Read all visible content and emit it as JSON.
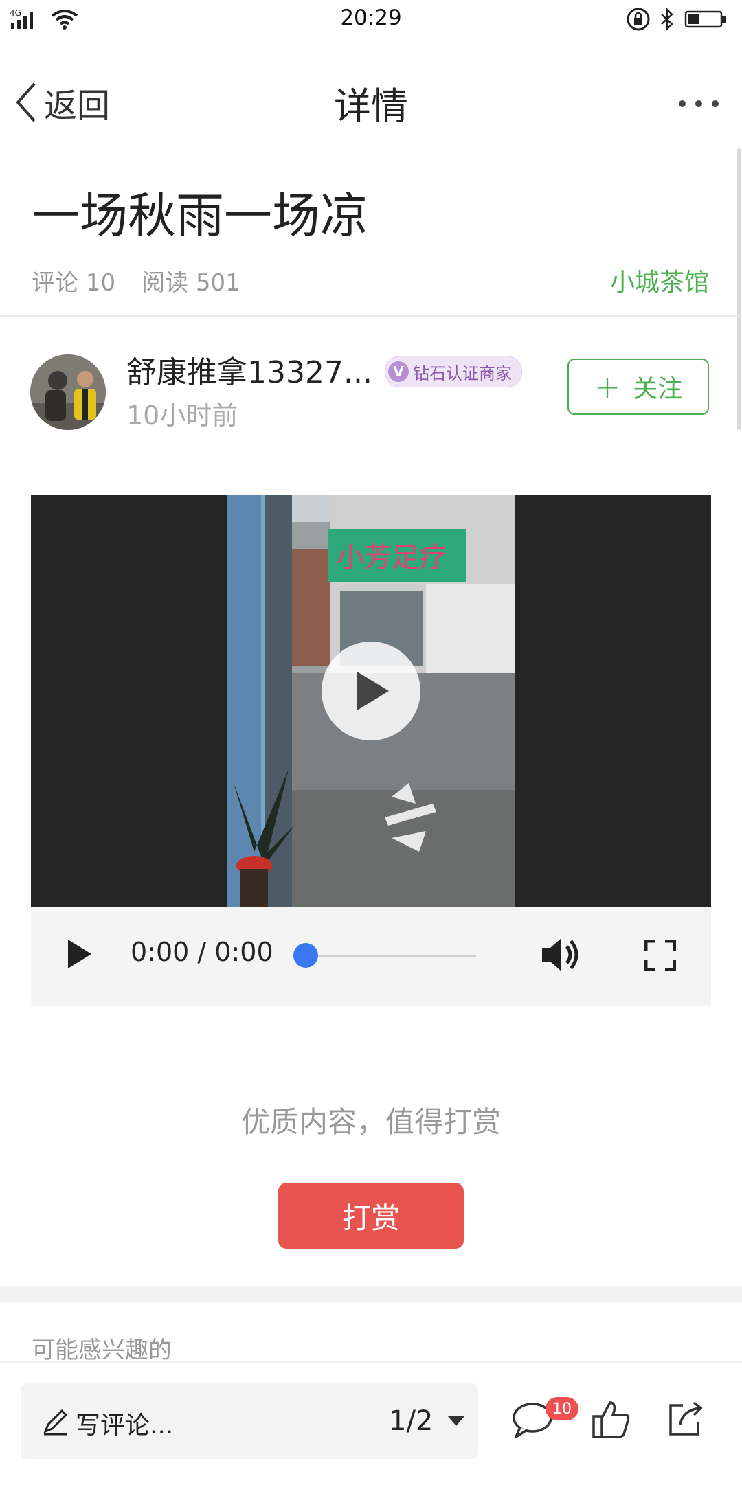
{
  "status_bar": {
    "time": "20:29",
    "network": "4G"
  },
  "nav": {
    "back_label": "返回",
    "title": "详情"
  },
  "article": {
    "title": "一场秋雨一场凉",
    "comments_label": "评论 10",
    "reads_label": "阅读 501",
    "channel": "小城茶馆"
  },
  "author": {
    "name": "舒康推拿13327...",
    "badge": "钻石认证商家",
    "badge_letter": "V",
    "time": "10小时前",
    "follow_label": "关注"
  },
  "video": {
    "shop_sign": "小芳足疗",
    "time_display": "0:00 / 0:00",
    "progress": 0
  },
  "reward": {
    "prompt": "优质内容，值得打赏",
    "button_label": "打赏"
  },
  "related": {
    "label": "可能感兴趣的"
  },
  "bottom_bar": {
    "comment_placeholder": "写评论...",
    "page_indicator": "1/2",
    "comment_count": "10"
  },
  "colors": {
    "accent_green": "#4caf50",
    "reward_red": "#e85550",
    "progress_blue": "#3a78f2",
    "badge_red": "#f05050"
  },
  "icons": [
    "signal-icon",
    "wifi-icon",
    "lock-icon",
    "bluetooth-icon",
    "battery-icon",
    "back-chevron-icon",
    "more-icon",
    "plus-icon",
    "play-icon",
    "volume-icon",
    "fullscreen-icon",
    "pencil-icon",
    "caret-down-icon",
    "comment-icon",
    "like-icon",
    "share-icon"
  ]
}
